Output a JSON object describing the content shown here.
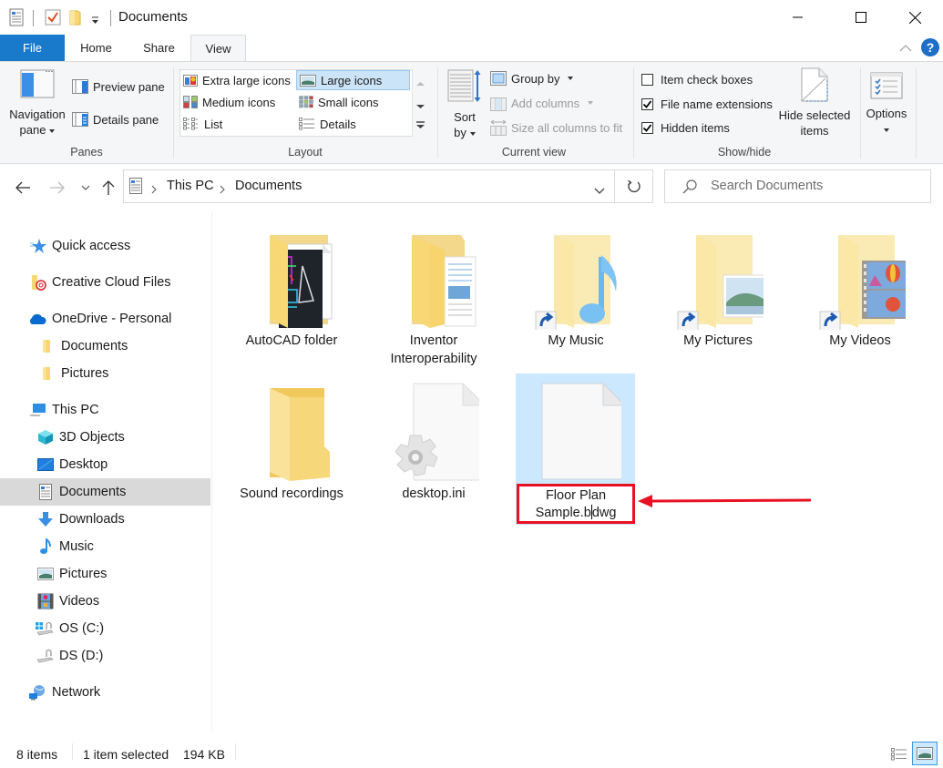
{
  "window": {
    "title": "Documents",
    "controls": {
      "minimize": "minimize",
      "maximize": "maximize",
      "close": "close"
    }
  },
  "quick_access_toolbar": {
    "icons": [
      "properties-icon",
      "checkmark-icon",
      "new-folder-icon",
      "customize-dropdown-icon"
    ]
  },
  "ribbon": {
    "tabs": [
      {
        "label": "File",
        "active": false
      },
      {
        "label": "Home",
        "active": false
      },
      {
        "label": "Share",
        "active": false
      },
      {
        "label": "View",
        "active": true
      }
    ],
    "panes": {
      "label": "Panes",
      "navigation_pane": {
        "line1": "Navigation",
        "line2": "pane"
      },
      "preview_pane": "Preview pane",
      "details_pane": "Details pane"
    },
    "layout": {
      "label": "Layout",
      "options": [
        {
          "label": "Extra large icons",
          "selected": false
        },
        {
          "label": "Large icons",
          "selected": true
        },
        {
          "label": "Medium icons",
          "selected": false
        },
        {
          "label": "Small icons",
          "selected": false
        },
        {
          "label": "List",
          "selected": false
        },
        {
          "label": "Details",
          "selected": false
        }
      ]
    },
    "current_view": {
      "label": "Current view",
      "sort_by": {
        "line1": "Sort",
        "line2": "by"
      },
      "group_by": "Group by",
      "add_columns": "Add columns",
      "size_all_columns": "Size all columns to fit"
    },
    "show_hide": {
      "label": "Show/hide",
      "item_check_boxes": {
        "label": "Item check boxes",
        "checked": false
      },
      "file_name_extensions": {
        "label": "File name extensions",
        "checked": true
      },
      "hidden_items": {
        "label": "Hidden items",
        "checked": true
      },
      "hide_selected": {
        "line1": "Hide selected",
        "line2": "items"
      }
    },
    "options": {
      "label": "Options"
    }
  },
  "navigation": {
    "breadcrumb": [
      "This PC",
      "Documents"
    ],
    "search_placeholder": "Search Documents"
  },
  "sidebar": {
    "items": [
      {
        "label": "Quick access",
        "icon": "star-icon",
        "level": 0
      },
      {
        "label": "Creative Cloud Files",
        "icon": "creative-cloud-folder-icon",
        "level": 0
      },
      {
        "label": "OneDrive - Personal",
        "icon": "onedrive-cloud-icon",
        "level": 0
      },
      {
        "label": "Documents",
        "icon": "folder-icon",
        "level": 1
      },
      {
        "label": "Pictures",
        "icon": "folder-icon",
        "level": 1
      },
      {
        "label": "This PC",
        "icon": "computer-icon",
        "level": 0
      },
      {
        "label": "3D Objects",
        "icon": "cube-icon",
        "level": 1
      },
      {
        "label": "Desktop",
        "icon": "desktop-icon",
        "level": 1
      },
      {
        "label": "Documents",
        "icon": "document-icon",
        "level": 1,
        "active": true
      },
      {
        "label": "Downloads",
        "icon": "download-arrow-icon",
        "level": 1
      },
      {
        "label": "Music",
        "icon": "music-note-icon",
        "level": 1
      },
      {
        "label": "Pictures",
        "icon": "picture-icon",
        "level": 1
      },
      {
        "label": "Videos",
        "icon": "film-icon",
        "level": 1
      },
      {
        "label": "OS (C:)",
        "icon": "windows-drive-icon",
        "level": 1
      },
      {
        "label": "DS (D:)",
        "icon": "drive-icon",
        "level": 1
      },
      {
        "label": "Network",
        "icon": "network-icon",
        "level": 0
      }
    ]
  },
  "files": [
    {
      "name": "AutoCAD folder",
      "type": "folder",
      "icon": "autocad-folder-icon"
    },
    {
      "name": "Inventor Interoperability",
      "type": "folder",
      "icon": "document-folder-icon"
    },
    {
      "name": "My Music",
      "type": "shortcut",
      "icon": "music-folder-shortcut-icon"
    },
    {
      "name": "My Pictures",
      "type": "shortcut",
      "icon": "pictures-folder-shortcut-icon"
    },
    {
      "name": "My Videos",
      "type": "shortcut",
      "icon": "videos-folder-shortcut-icon"
    },
    {
      "name": "Sound recordings",
      "type": "folder",
      "icon": "folder-icon"
    },
    {
      "name": "desktop.ini",
      "type": "file",
      "icon": "settings-file-icon"
    },
    {
      "name": "Floor Plan Sample.bdwg",
      "type": "file",
      "icon": "blank-file-icon",
      "selected": true,
      "renaming": true
    }
  ],
  "rename": {
    "line1": "Floor Plan",
    "before_caret": "Sample.b",
    "after_caret": "dwg"
  },
  "annotation": {
    "color": "#e81123",
    "type": "arrow-pointing-left"
  },
  "status": {
    "item_count": "8 items",
    "selection": "1 item selected",
    "size": "194 KB"
  },
  "colors": {
    "file_tab": "#1979ca",
    "selection_bg": "#cce8ff",
    "annotation_red": "#e81123",
    "sidebar_active": "#d9d9d9"
  }
}
